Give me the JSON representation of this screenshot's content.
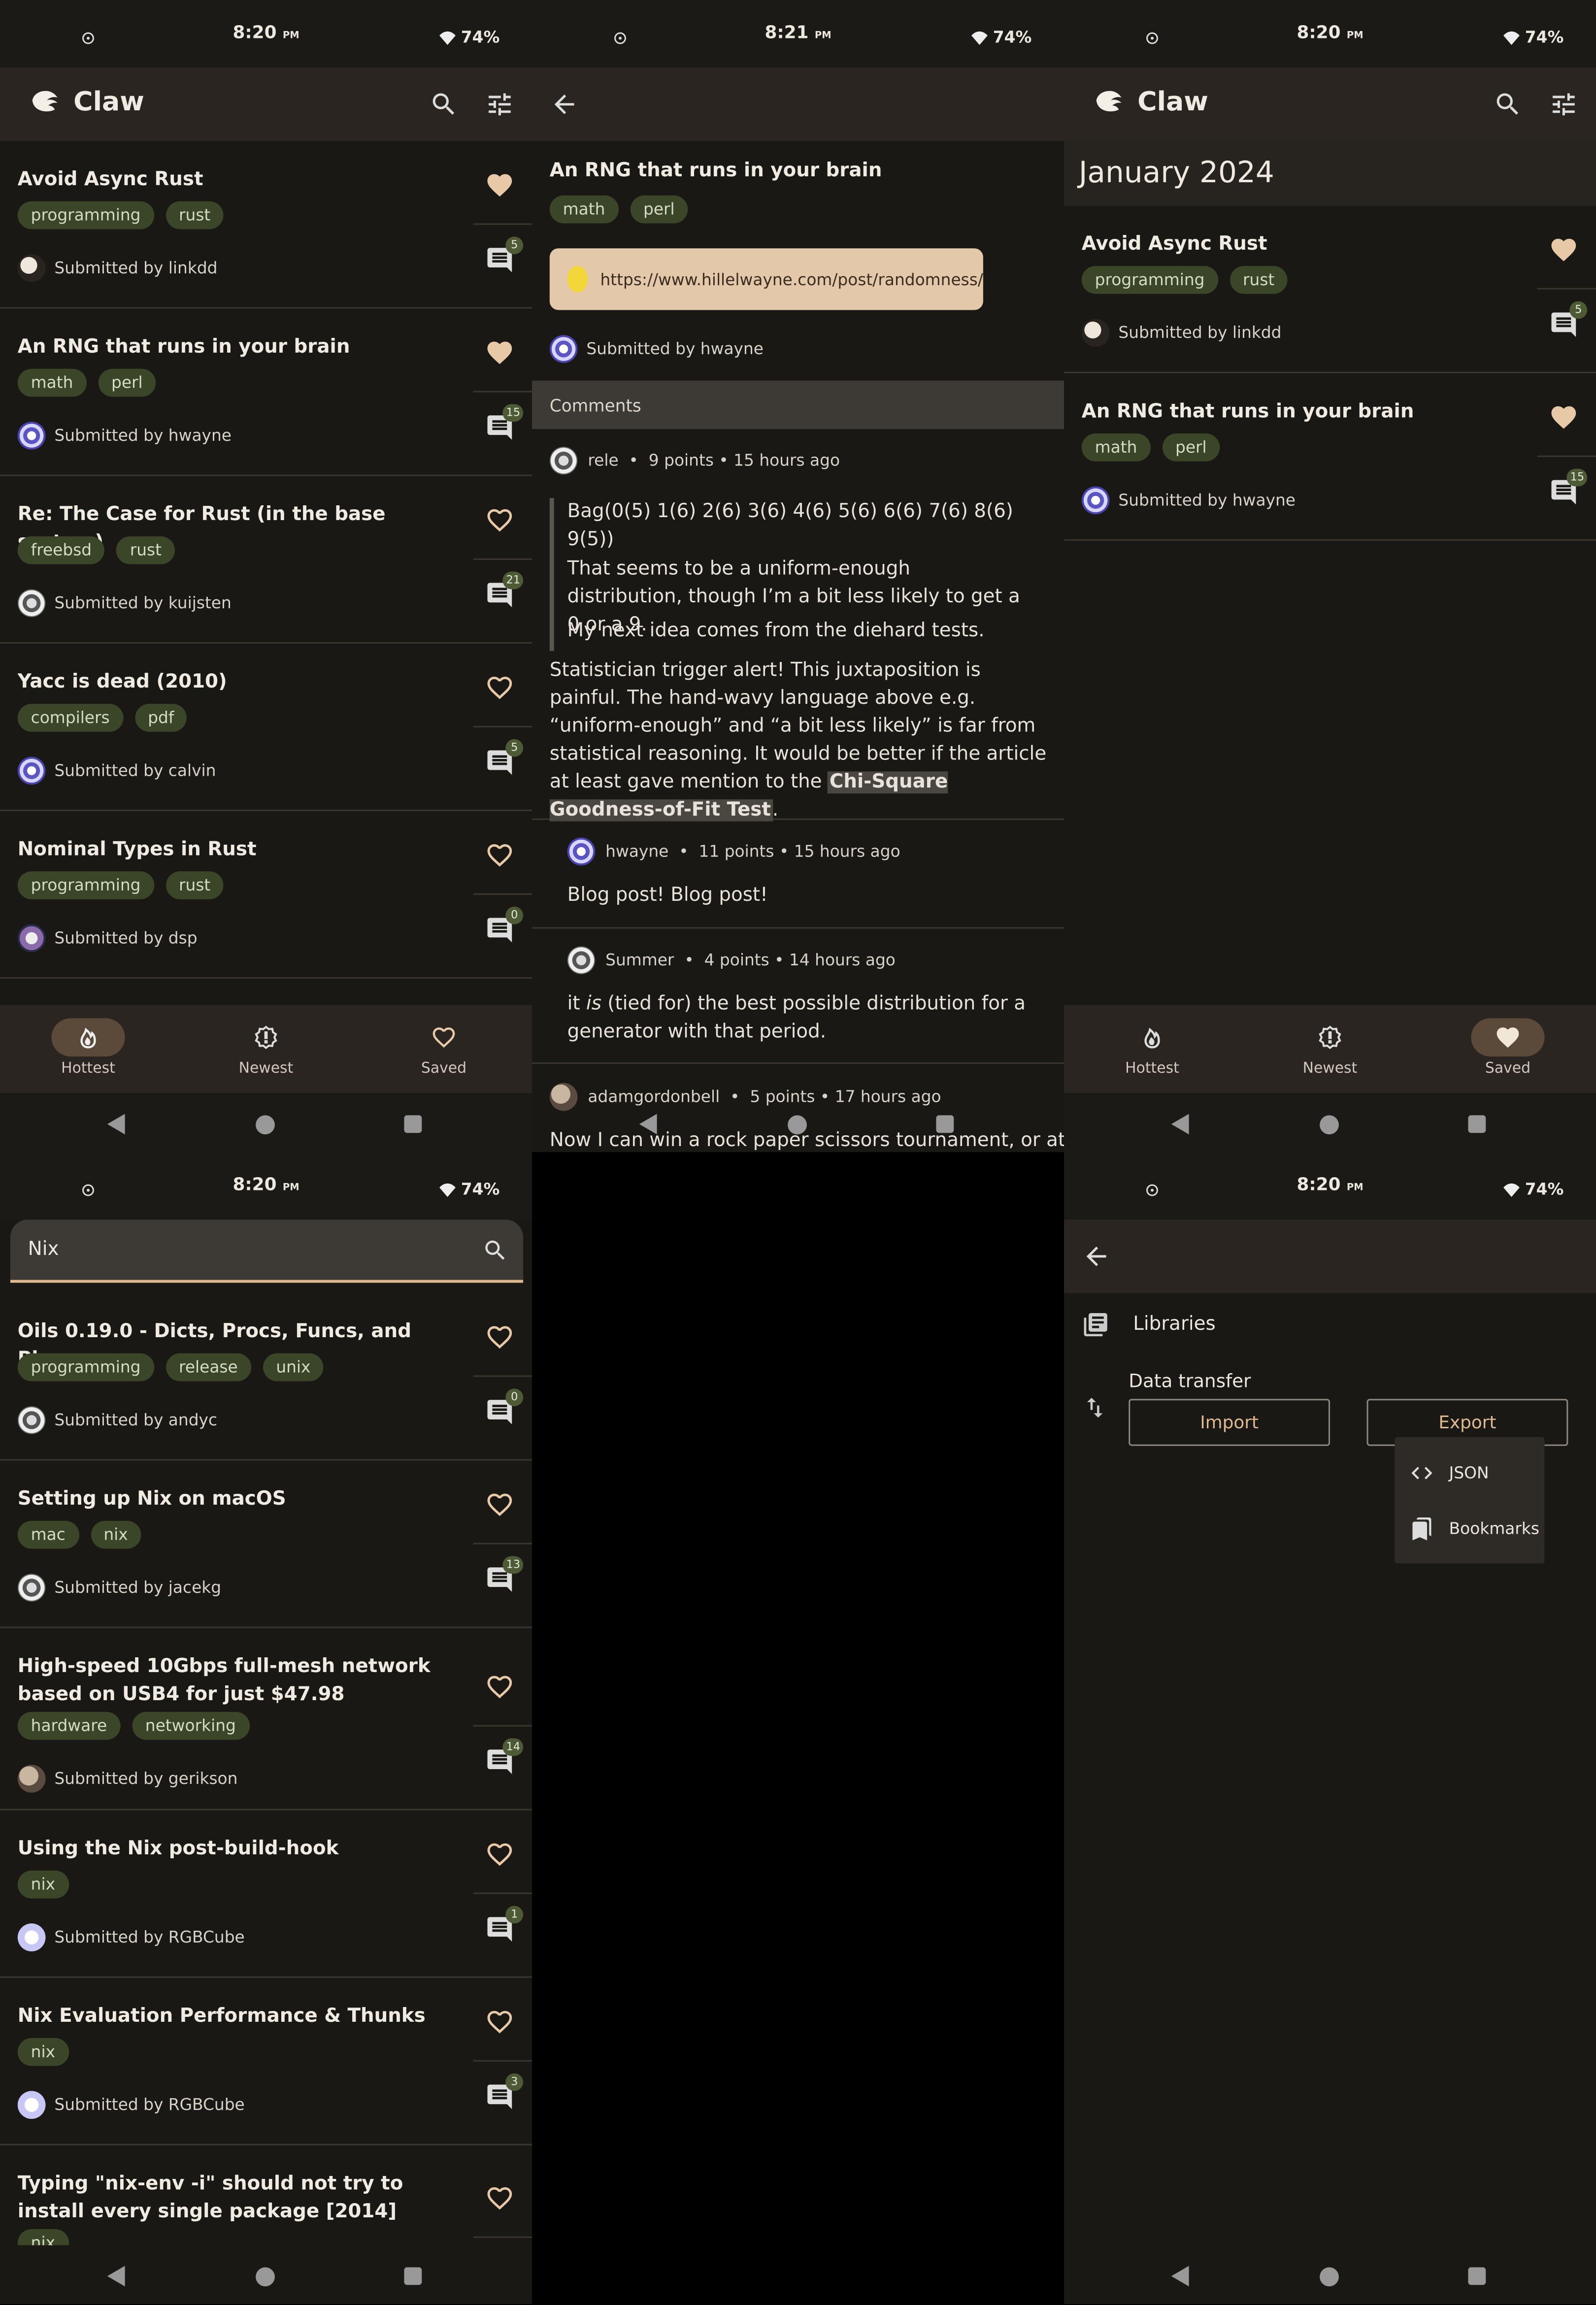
{
  "status": {
    "time_a": "8:20",
    "time_b": "8:21",
    "ampm": "PM",
    "battery": "74%"
  },
  "app": {
    "title": "Claw"
  },
  "hottest": {
    "stories": [
      {
        "title": "Avoid Async Rust",
        "tags": [
          "programming",
          "rust"
        ],
        "submitter": "Submitted by linkdd",
        "comments": "5",
        "saved": true
      },
      {
        "title": "An RNG that runs in your brain",
        "tags": [
          "math",
          "perl"
        ],
        "submitter": "Submitted by hwayne",
        "comments": "15",
        "saved": true
      },
      {
        "title": "Re: The Case for Rust (in the base system)",
        "tags": [
          "freebsd",
          "rust"
        ],
        "submitter": "Submitted by kuijsten",
        "comments": "21",
        "saved": false
      },
      {
        "title": "Yacc is dead (2010)",
        "tags": [
          "compilers",
          "pdf"
        ],
        "submitter": "Submitted by calvin",
        "comments": "5",
        "saved": false
      },
      {
        "title": "Nominal Types in Rust",
        "tags": [
          "programming",
          "rust"
        ],
        "submitter": "Submitted by dsp",
        "comments": "0",
        "saved": false
      }
    ]
  },
  "nav": {
    "hottest": "Hottest",
    "newest": "Newest",
    "saved": "Saved"
  },
  "detail": {
    "title": "An RNG that runs in your brain",
    "tags": [
      "math",
      "perl"
    ],
    "url": "https://www.hillelwayne.com/post/randomness/",
    "submitter": "Submitted by hwayne",
    "comments_header": "Comments",
    "comments": [
      {
        "author": "rele",
        "meta": "9 points • 15 hours ago",
        "quote1": "Bag(0(5) 1(6) 2(6) 3(6) 4(6) 5(6) 6(6) 7(6) 8(6) 9(5))",
        "quote2": "That seems to be a uniform-enough distribution, though I’m a bit less likely to get a 0 or a 9.",
        "quote3": "My next idea comes from the diehard tests.",
        "body": "Statistician trigger alert! This juxtaposition is painful. The hand-wavy language above e.g. “uniform-enough” and “a bit less likely” is far from statistical reasoning. It would be better if the article at least gave mention to the ",
        "link": "Chi-Square Goodness-of-Fit Test",
        "after": "."
      },
      {
        "author": "hwayne",
        "meta": "11 points • 15 hours ago",
        "body": "Blog post! Blog post!"
      },
      {
        "author": "Summer",
        "meta": "4 points • 14 hours ago",
        "pre": "it ",
        "em": "is",
        "body": " (tied for) the best possible distribution for a generator with that period."
      },
      {
        "author": "adamgordonbell",
        "meta": "5 points • 17 hours ago",
        "body": "Now I can win a rock paper scissors tournament, or at"
      }
    ]
  },
  "saved": {
    "month": "January 2024",
    "stories": [
      {
        "title": "Avoid Async Rust",
        "tags": [
          "programming",
          "rust"
        ],
        "submitter": "Submitted by linkdd",
        "comments": "5"
      },
      {
        "title": "An RNG that runs in your brain",
        "tags": [
          "math",
          "perl"
        ],
        "submitter": "Submitted by hwayne",
        "comments": "15"
      }
    ]
  },
  "search": {
    "query": "Nix",
    "results": [
      {
        "title": "Oils 0.19.0 - Dicts, Procs, Funcs, and Places",
        "tags": [
          "programming",
          "release",
          "unix"
        ],
        "submitter": "Submitted by andyc",
        "comments": "0"
      },
      {
        "title": "Setting up Nix on macOS",
        "tags": [
          "mac",
          "nix"
        ],
        "submitter": "Submitted by jacekg",
        "comments": "13"
      },
      {
        "title": "High-speed 10Gbps full-mesh network based on USB4 for just $47.98",
        "tags": [
          "hardware",
          "networking"
        ],
        "submitter": "Submitted by gerikson",
        "comments": "14"
      },
      {
        "title": "Using the Nix post-build-hook",
        "tags": [
          "nix"
        ],
        "submitter": "Submitted by RGBCube",
        "comments": "1"
      },
      {
        "title": "Nix Evaluation Performance & Thunks",
        "tags": [
          "nix"
        ],
        "submitter": "Submitted by RGBCube",
        "comments": "3"
      },
      {
        "title": "Typing \"nix-env -i\" should not try to install every single package [2014]",
        "tags": [
          "nix"
        ],
        "submitter": "",
        "comments": ""
      }
    ]
  },
  "settings": {
    "libraries": "Libraries",
    "data_transfer": "Data transfer",
    "import": "Import",
    "export": "Export",
    "menu_json": "JSON",
    "menu_bookmarks": "Bookmarks"
  },
  "colors": {
    "accent": "#e0b98f",
    "tag_bg": "#3b4629",
    "background": "#1a1815",
    "appbar": "#2a2520"
  }
}
